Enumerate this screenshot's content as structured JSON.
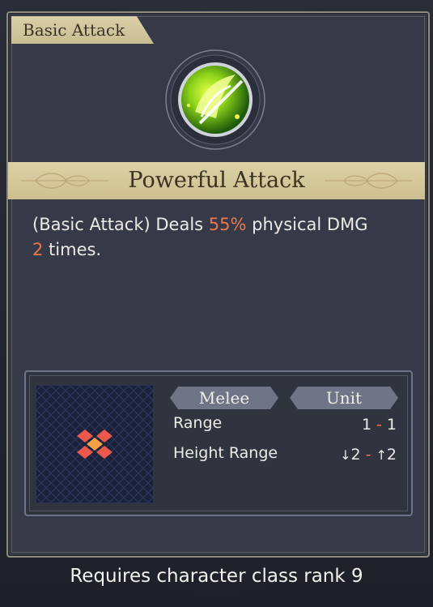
{
  "card": {
    "category": "Basic Attack",
    "skill_name": "Powerful Attack",
    "icon": "green-slash-icon",
    "description": {
      "prefix": "(Basic Attack) Deals ",
      "percent": "55%",
      "middle": " physical DMG",
      "count": "2",
      "suffix": " times."
    }
  },
  "stats": {
    "attack_type": "Melee",
    "target_type": "Unit",
    "range_label": "Range",
    "range_min": "1",
    "range_max": "1",
    "height_label": "Height Range",
    "height_down": "2",
    "height_up": "2"
  },
  "footer": {
    "requirement": "Requires character class rank 9"
  },
  "colors": {
    "highlight": "#e9784d",
    "banner": "#d6ca9e",
    "card_bg": "#363a48",
    "tile_red": "#e9584a",
    "tile_orange": "#f2a046"
  }
}
